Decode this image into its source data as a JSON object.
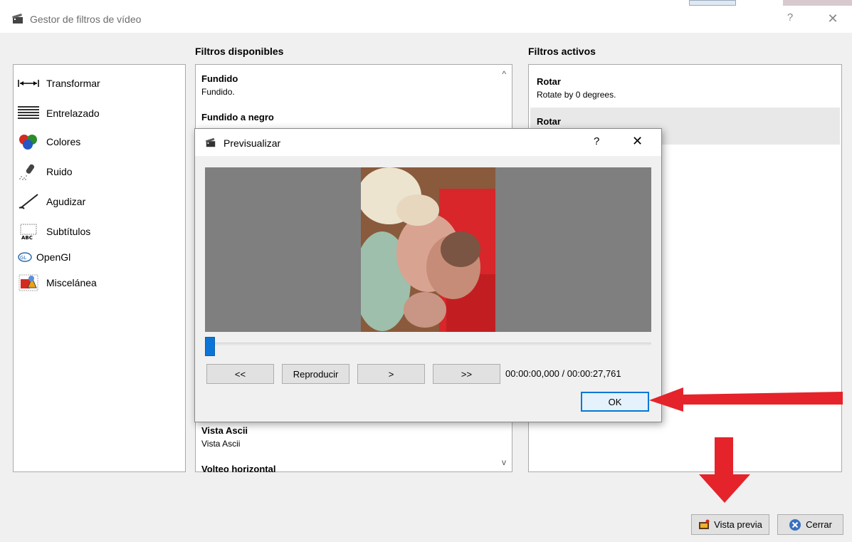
{
  "window": {
    "title": "Gestor de filtros de vídeo",
    "help_glyph": "?",
    "close_glyph": "✕"
  },
  "categories_panel": {
    "items": [
      {
        "label": "Transformar",
        "icon": "transform-icon"
      },
      {
        "label": "Entrelazado",
        "icon": "interlace-icon"
      },
      {
        "label": "Colores",
        "icon": "colors-icon"
      },
      {
        "label": "Ruido",
        "icon": "noise-icon"
      },
      {
        "label": "Agudizar",
        "icon": "sharpen-icon"
      },
      {
        "label": "Subtítulos",
        "icon": "subtitles-icon"
      },
      {
        "label": "OpenGl",
        "icon": "opengl-icon"
      },
      {
        "label": "Miscelánea",
        "icon": "misc-icon"
      }
    ]
  },
  "available": {
    "heading": "Filtros disponibles",
    "filters": [
      {
        "name": "Fundido",
        "desc": "Fundido."
      },
      {
        "name": "Fundido a negro",
        "desc": ""
      },
      {
        "name": "Vista Ascii",
        "desc": "Vista Ascii"
      },
      {
        "name": "Volteo horizontal",
        "desc": ""
      }
    ],
    "scroll_up": "^",
    "scroll_down": "v"
  },
  "active": {
    "heading": "Filtros activos",
    "filters": [
      {
        "name": "Rotar",
        "desc": "Rotate by 0 degrees."
      },
      {
        "name": "Rotar",
        "desc": ""
      }
    ]
  },
  "footer": {
    "preview_label": "Vista previa",
    "close_label": "Cerrar"
  },
  "dialog": {
    "title": "Previsualizar",
    "help_glyph": "?",
    "close_glyph": "✕",
    "buttons": {
      "rewind": "<<",
      "play": "Reproducir",
      "next": ">",
      "forward": ">>"
    },
    "time": "00:00:00,000 / 00:00:27,761",
    "ok_label": "OK",
    "progress": 0
  },
  "colors": {
    "accent": "#0078d7",
    "arrow": "#e5232b"
  }
}
